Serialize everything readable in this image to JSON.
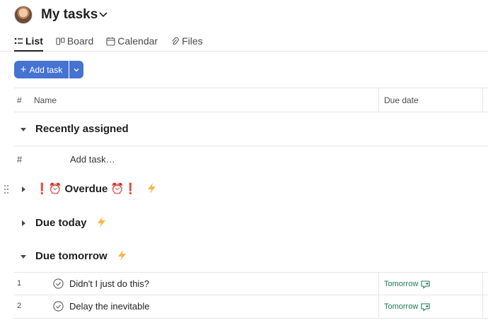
{
  "header": {
    "title": "My tasks",
    "tabs": [
      {
        "label": "List",
        "icon": "list-icon",
        "active": true
      },
      {
        "label": "Board",
        "icon": "board-icon",
        "active": false
      },
      {
        "label": "Calendar",
        "icon": "calendar-icon",
        "active": false
      },
      {
        "label": "Files",
        "icon": "paperclip-icon",
        "active": false
      }
    ]
  },
  "toolbar": {
    "add_task_label": "Add task"
  },
  "table": {
    "columns": {
      "hash": "#",
      "name": "Name",
      "due": "Due date"
    }
  },
  "sections": {
    "recent": {
      "title": "Recently assigned"
    },
    "add_task": {
      "hash": "#",
      "placeholder": "Add task…"
    },
    "overdue": {
      "title": "❗⏰ Overdue ⏰❗"
    },
    "today": {
      "title": "Due today"
    },
    "tomorrow": {
      "title": "Due tomorrow",
      "tasks": [
        {
          "num": "1",
          "name": "Didn't I just do this?",
          "due": "Tomorrow"
        },
        {
          "num": "2",
          "name": "Delay the inevitable",
          "due": "Tomorrow"
        }
      ]
    }
  },
  "colors": {
    "accent": "#4573d2",
    "due_green": "#1f7a50",
    "bolt": "#f5b74f"
  }
}
